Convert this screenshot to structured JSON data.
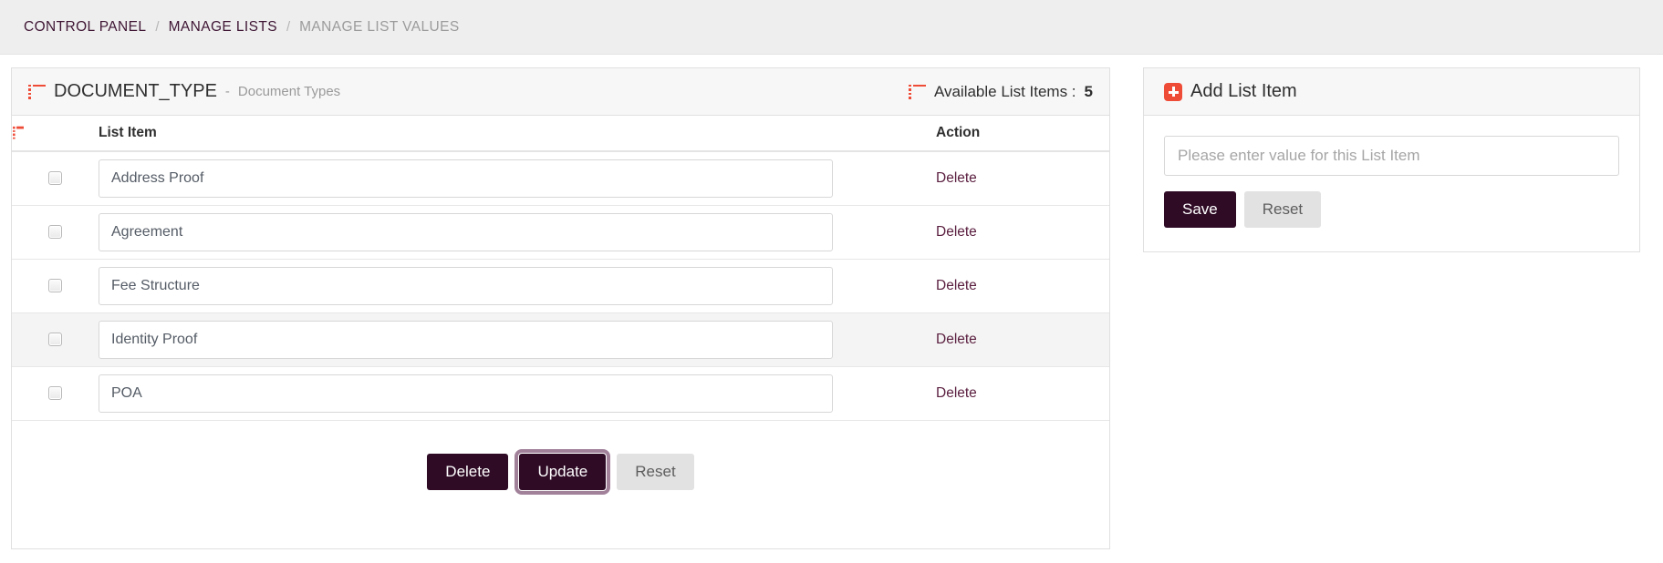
{
  "breadcrumb": {
    "items": [
      {
        "label": "CONTROL PANEL",
        "active": false
      },
      {
        "label": "MANAGE LISTS",
        "active": false
      },
      {
        "label": "MANAGE LIST VALUES",
        "active": true
      }
    ],
    "separator": "/"
  },
  "colors": {
    "accent_red": "#ef4c38",
    "primary_purple": "#2f0b26",
    "link_purple": "#5b2040",
    "breadcrumb_purple": "#3f1634",
    "muted_gray": "#9a9a9a",
    "panel_head_bg": "#f7f7f7",
    "row_hover_bg": "#f4f4f4"
  },
  "left_panel": {
    "icon": "list-icon",
    "title": "DOCUMENT_TYPE",
    "title_separator": "-",
    "subtitle": "Document Types",
    "count_icon": "list-icon",
    "count_label": "Available List Items :",
    "count_value": "5",
    "table": {
      "headers": {
        "check": "",
        "check_icon": "list-icon",
        "item": "List Item",
        "action": "Action"
      },
      "rows": [
        {
          "checked": false,
          "value": "Address Proof",
          "action": "Delete",
          "hover": false
        },
        {
          "checked": false,
          "value": "Agreement",
          "action": "Delete",
          "hover": false
        },
        {
          "checked": false,
          "value": "Fee Structure",
          "action": "Delete",
          "hover": false
        },
        {
          "checked": false,
          "value": "Identity Proof",
          "action": "Delete",
          "hover": true
        },
        {
          "checked": false,
          "value": "POA",
          "action": "Delete",
          "hover": false
        }
      ]
    },
    "footer_buttons": [
      {
        "label": "Delete",
        "style": "primary",
        "focused": false
      },
      {
        "label": "Update",
        "style": "primary",
        "focused": true
      },
      {
        "label": "Reset",
        "style": "default",
        "focused": false
      }
    ]
  },
  "right_panel": {
    "icon": "add-plus-icon",
    "title": "Add List Item",
    "input": {
      "value": "",
      "placeholder": "Please enter value for this List Item"
    },
    "buttons": [
      {
        "label": "Save",
        "style": "primary"
      },
      {
        "label": "Reset",
        "style": "default"
      }
    ]
  }
}
